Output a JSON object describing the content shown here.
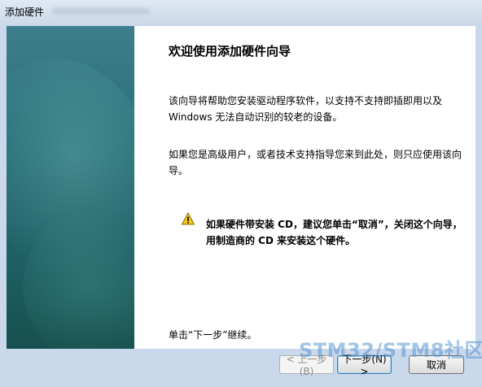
{
  "window": {
    "title": "添加硬件"
  },
  "content": {
    "heading": "欢迎使用添加硬件向导",
    "paragraph1": "该向导将帮助您安装驱动程序软件，以支持不支持即插即用以及 Windows 无法自动识别的较老的设备。",
    "paragraph2": "如果您是高级用户，或者技术支持指导您来到此处，则只应使用该向导。",
    "warning": "如果硬件带安装 CD，建议您单击“取消”，关闭这个向导，用制造商的 CD 来安装这个硬件。",
    "footer": "单击“下一步”继续。"
  },
  "buttons": {
    "back": "< 上一步(B)",
    "next": "下一步(N) >",
    "cancel": "取消"
  },
  "watermark": {
    "text": "STM32/STM8社区"
  },
  "colors": {
    "side_panel": "#2a6f78",
    "frame": "#c9d8ea"
  },
  "icons": {
    "warning": "warning-icon"
  }
}
